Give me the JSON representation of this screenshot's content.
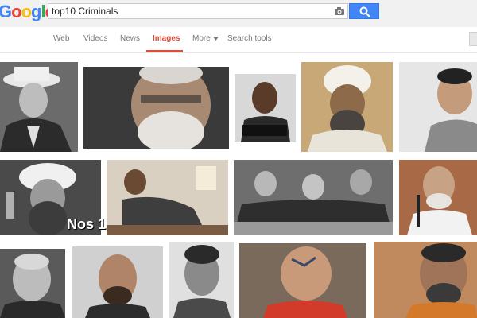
{
  "logo": {
    "text": "Google"
  },
  "search": {
    "query": "top10 Criminals"
  },
  "nav": {
    "web": "Web",
    "videos": "Videos",
    "news": "News",
    "images": "Images",
    "more": "More",
    "search_tools": "Search tools"
  },
  "results": {
    "overlay_text": "Nos 1"
  },
  "icons": {
    "camera": "camera-icon",
    "search": "search-icon",
    "dropdown": "chevron-down-icon"
  },
  "colors": {
    "accent": "#4285f4",
    "active_tab": "#dd4b39"
  }
}
